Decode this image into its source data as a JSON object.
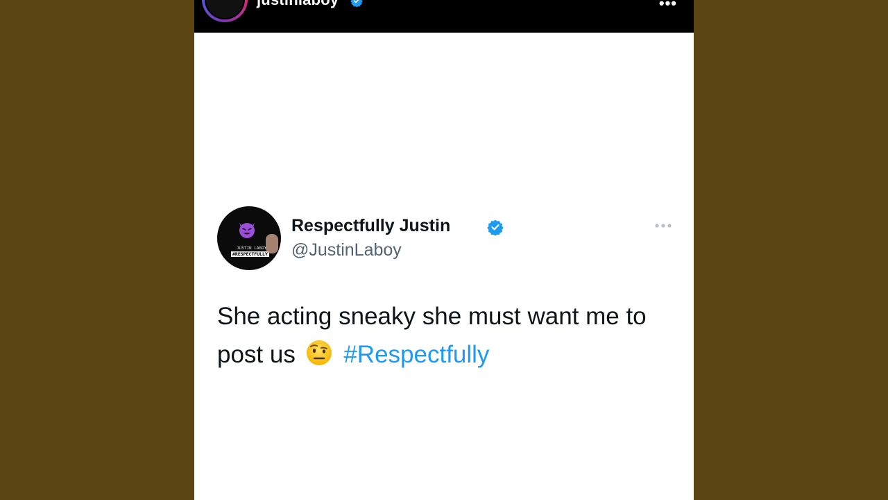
{
  "instagram_header": {
    "username": "justinlaboy",
    "verified_icon": "verified-badge-icon",
    "more_icon": "more-options-icon",
    "more_label": "•••"
  },
  "tweet": {
    "display_name": "Respectfully Justin",
    "handle": "@JustinLaboy",
    "verified_icon": "verified-badge-icon",
    "more_icon": "more-options-icon",
    "text_line1": "She acting sneaky she must want me to",
    "text_line2": "post us",
    "emoji_icon": "raised-eyebrow-emoji-icon",
    "hashtag": "#Respectfully",
    "avatar": {
      "emoji_icon": "smiling-devil-emoji-icon",
      "caption_top": "JUSTIN LABOY",
      "caption_bottom": "#RESPECTFULLY"
    }
  },
  "colors": {
    "side_background": "#5b4512",
    "card_background": "#ffffff",
    "header_background": "#000000",
    "verified_blue": "#1d9bf0",
    "hashtag_blue": "#1d9bf0",
    "text_primary": "#0f1419",
    "text_secondary": "#536471"
  }
}
